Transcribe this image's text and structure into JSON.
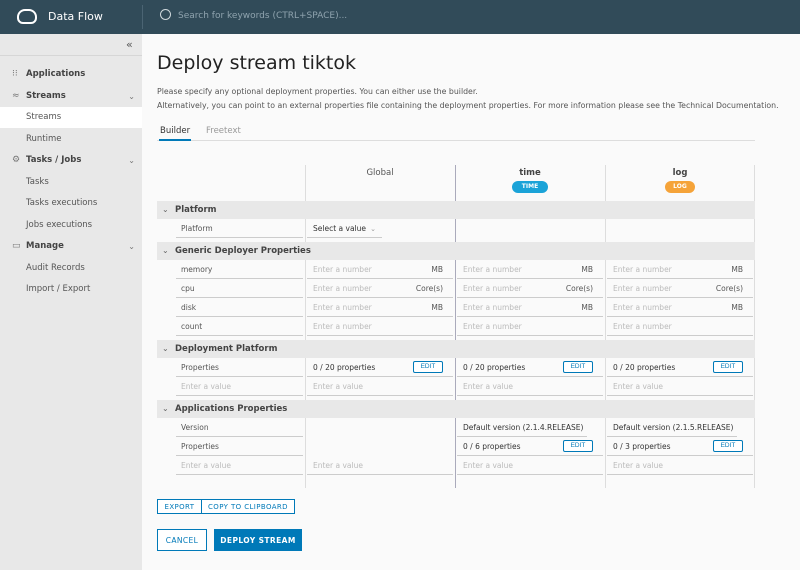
{
  "header": {
    "brand": "Data Flow",
    "search_placeholder": "Search for keywords (CTRL+SPACE)..."
  },
  "sidebar": {
    "items": [
      {
        "label": "Applications",
        "type": "group",
        "icon": "grid-icon"
      },
      {
        "label": "Streams",
        "type": "group",
        "icon": "streams-icon",
        "chevron": true
      },
      {
        "label": "Streams",
        "type": "sub",
        "active": true
      },
      {
        "label": "Runtime",
        "type": "sub"
      },
      {
        "label": "Tasks / Jobs",
        "type": "group",
        "icon": "tasks-icon",
        "chevron": true
      },
      {
        "label": "Tasks",
        "type": "sub"
      },
      {
        "label": "Tasks executions",
        "type": "sub"
      },
      {
        "label": "Jobs executions",
        "type": "sub"
      },
      {
        "label": "Manage",
        "type": "group",
        "icon": "manage-icon",
        "chevron": true
      },
      {
        "label": "Audit Records",
        "type": "sub"
      },
      {
        "label": "Import / Export",
        "type": "sub"
      }
    ]
  },
  "page": {
    "title": "Deploy stream tiktok",
    "desc1": "Please specify any optional deployment properties. You can either use the builder.",
    "desc2": "Alternatively, you can point to an external properties file containing the deployment properties. For more information please see the Technical Documentation.",
    "tabs": [
      "Builder",
      "Freetext"
    ]
  },
  "table": {
    "columns": [
      {
        "label": "Global"
      },
      {
        "label": "time",
        "badge": "TIME",
        "color": "#1ba3d8"
      },
      {
        "label": "log",
        "badge": "LOG",
        "color": "#f5a339"
      }
    ],
    "sections": [
      {
        "title": "Platform",
        "rows": [
          {
            "label": "Platform",
            "cells": [
              {
                "select": "Select a value"
              },
              null,
              null
            ]
          }
        ]
      },
      {
        "title": "Generic Deployer Properties",
        "rows": [
          {
            "label": "memory",
            "cells": [
              {
                "ph": "Enter a number",
                "unit": "MB"
              },
              {
                "ph": "Enter a number",
                "unit": "MB"
              },
              {
                "ph": "Enter a number",
                "unit": "MB"
              }
            ]
          },
          {
            "label": "cpu",
            "cells": [
              {
                "ph": "Enter a number",
                "unit": "Core(s)"
              },
              {
                "ph": "Enter a number",
                "unit": "Core(s)"
              },
              {
                "ph": "Enter a number",
                "unit": "Core(s)"
              }
            ]
          },
          {
            "label": "disk",
            "cells": [
              {
                "ph": "Enter a number",
                "unit": "MB"
              },
              {
                "ph": "Enter a number",
                "unit": "MB"
              },
              {
                "ph": "Enter a number",
                "unit": "MB"
              }
            ]
          },
          {
            "label": "count",
            "cells": [
              {
                "ph": "Enter a number"
              },
              {
                "ph": "Enter a number"
              },
              {
                "ph": "Enter a number"
              }
            ]
          }
        ]
      },
      {
        "title": "Deployment Platform",
        "rows": [
          {
            "label": "Properties",
            "cells": [
              {
                "count": "0 / 20 properties",
                "edit": "EDIT"
              },
              {
                "count": "0 / 20 properties",
                "edit": "EDIT"
              },
              {
                "count": "0 / 20 properties",
                "edit": "EDIT"
              }
            ]
          },
          {
            "labelph": "Enter a value",
            "cells": [
              {
                "ph": "Enter a value"
              },
              {
                "ph": "Enter a value"
              },
              {
                "ph": "Enter a value"
              }
            ]
          }
        ]
      },
      {
        "title": "Applications Properties",
        "rows": [
          {
            "label": "Version",
            "cells": [
              null,
              {
                "select": "Default version (2.1.4.RELEASE)"
              },
              {
                "select": "Default version (2.1.5.RELEASE)"
              }
            ]
          },
          {
            "label": "Properties",
            "cells": [
              null,
              {
                "count": "0 / 6 properties",
                "edit": "EDIT"
              },
              {
                "count": "0 / 3 properties",
                "edit": "EDIT"
              }
            ]
          },
          {
            "labelph": "Enter a value",
            "cells": [
              {
                "ph": "Enter a value"
              },
              {
                "ph": "Enter a value"
              },
              {
                "ph": "Enter a value"
              }
            ]
          }
        ]
      }
    ]
  },
  "actions": {
    "export": "EXPORT",
    "copy": "COPY TO CLIPBOARD",
    "cancel": "CANCEL",
    "deploy": "DEPLOY STREAM"
  }
}
